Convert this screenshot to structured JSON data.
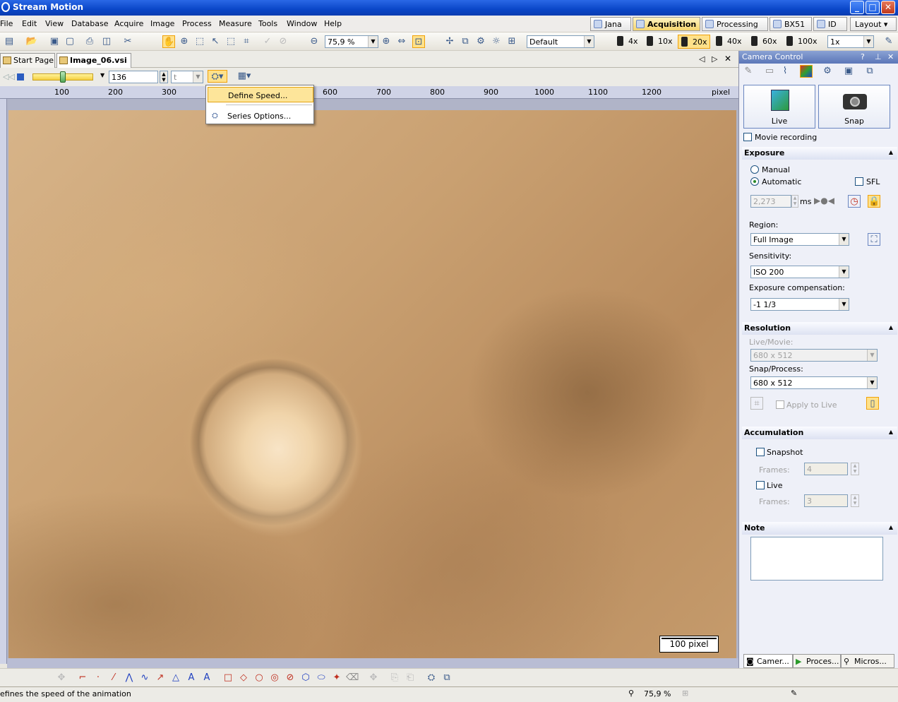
{
  "window": {
    "title": "Stream Motion",
    "min": "_",
    "max": "□",
    "close": "✕"
  },
  "menu": [
    "File",
    "Edit",
    "View",
    "Database",
    "Acquire",
    "Image",
    "Process",
    "Measure",
    "Tools",
    "Window",
    "Help"
  ],
  "layout_tabs": [
    "Jana",
    "Acquisition",
    "Processing",
    "BX51",
    "ID",
    "Layout"
  ],
  "toolbar": {
    "zoom": "75,9 %",
    "preset": "Default",
    "objectives": [
      "4x",
      "10x",
      "20x",
      "40x",
      "60x",
      "100x"
    ],
    "magnification": "1x"
  },
  "doc_tabs": [
    "Start Page",
    "Image_06.vsi"
  ],
  "series": {
    "frame": "136",
    "dimension": "t"
  },
  "ruler": {
    "ticks": [
      "100",
      "200",
      "300",
      "400",
      "500",
      "600",
      "700",
      "800",
      "900",
      "1000",
      "1100",
      "1200"
    ],
    "unit": "pixel"
  },
  "scalebar": "100 pixel",
  "dropdown": {
    "define_speed": "Define Speed...",
    "series_options": "Series Options..."
  },
  "camera_panel": {
    "title": "Camera Control",
    "live": "Live",
    "snap": "Snap",
    "movie_recording": "Movie recording",
    "exposure": {
      "header": "Exposure",
      "manual": "Manual",
      "automatic": "Automatic",
      "sfl": "SFL",
      "time": "2,273",
      "unit": "ms"
    },
    "region_label": "Region:",
    "region": "Full Image",
    "sensitivity_label": "Sensitivity:",
    "sensitivity": "ISO 200",
    "compensation_label": "Exposure compensation:",
    "compensation": "-1 1/3",
    "resolution": {
      "header": "Resolution",
      "live_label": "Live/Movie:",
      "live": "680 x 512",
      "snap_label": "Snap/Process:",
      "snap": "680 x 512",
      "apply": "Apply to Live"
    },
    "accumulation": {
      "header": "Accumulation",
      "snapshot": "Snapshot",
      "frames_label": "Frames:",
      "snapshot_frames": "4",
      "live": "Live",
      "live_frames": "3"
    },
    "note": {
      "header": "Note"
    },
    "bottom_tabs": [
      "Camer...",
      "Proces...",
      "Micros..."
    ]
  },
  "status": {
    "text": "efines the speed of the animation",
    "zoom": "75,9 %"
  }
}
